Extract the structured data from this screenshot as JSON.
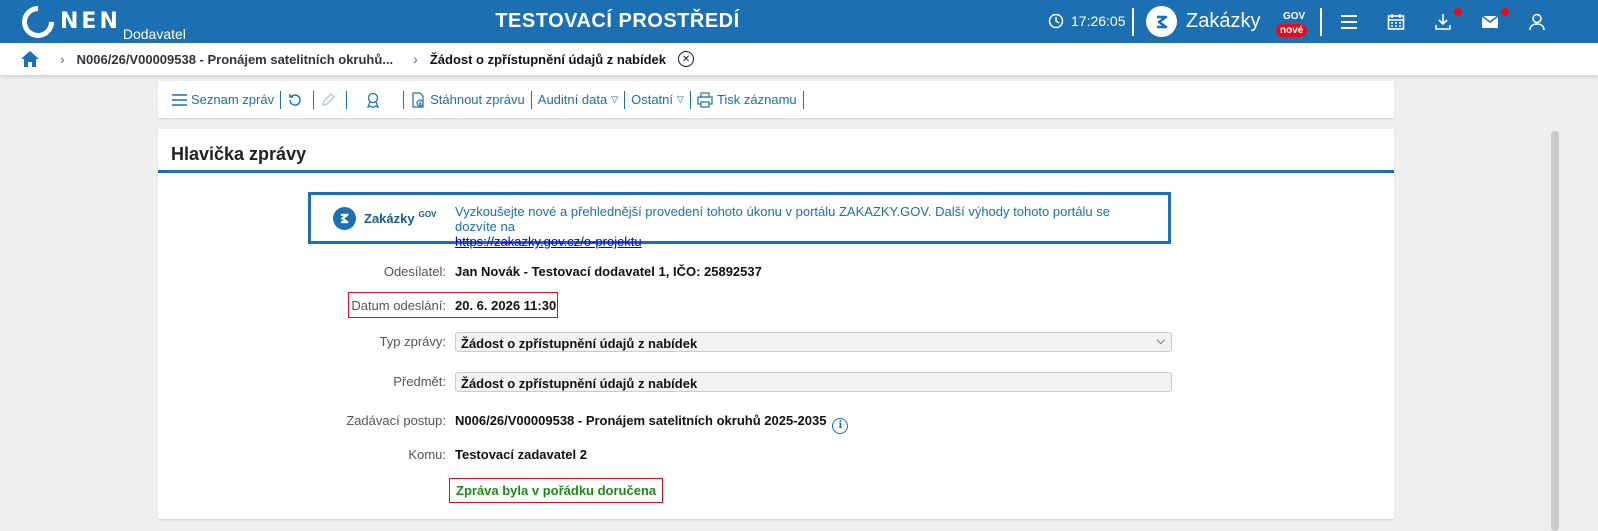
{
  "topbar": {
    "logo_text": "NEN",
    "logo_sub": "Dodavatel",
    "env_title": "TESTOVACÍ PROSTŘEDÍ",
    "clock": "17:26:05",
    "zakazky_name": "Zakázky",
    "zakazky_gov": "GOV",
    "zakazky_new_badge": "nové",
    "brand_color": "#1c6fb0",
    "icons": [
      "menu-icon",
      "calendar-icon",
      "download-icon",
      "mail-icon",
      "user-icon"
    ]
  },
  "breadcrumb": {
    "item1": "N006/26/V00009538 - Pronájem satelitních okruhů...",
    "current": "Žádost o zpřístupnění údajů z nabídek"
  },
  "toolbar": {
    "seznam": "Seznam zpráv",
    "stahnout": "Stáhnout zprávu",
    "auditni": "Auditní data",
    "ostatni": "Ostatní",
    "tisk": "Tisk záznamu"
  },
  "panel": {
    "title": "Hlavička zprávy",
    "promo": {
      "name": "Zakázky",
      "gov": "GOV",
      "text": "Vyzkoušejte nové a přehlednější provedení tohoto úkonu v portálu ZAKAZKY.GOV. Další výhody tohoto portálu se dozvíte na",
      "link": "https://zakazky.gov.cz/o-projektu"
    },
    "fields": {
      "odesilatel_label": "Odesílatel:",
      "odesilatel_value": "Jan Novák - Testovací dodavatel 1, IČO: 25892537",
      "datum_label": "Datum odeslání:",
      "datum_value": "20. 6. 2026 11:30",
      "typ_label": "Typ zprávy:",
      "typ_value": "Žádost o zpřístupnění údajů z nabídek",
      "predmet_label": "Předmět:",
      "predmet_value": "Žádost o zpřístupnění údajů z nabídek",
      "postup_label": "Zadávací postup:",
      "postup_value": "N006/26/V00009538 - Pronájem satelitních okruhů 2025-2035",
      "komu_label": "Komu:",
      "komu_value": "Testovací zadavatel 2"
    },
    "status": "Zpráva byla v pořádku doručena"
  }
}
